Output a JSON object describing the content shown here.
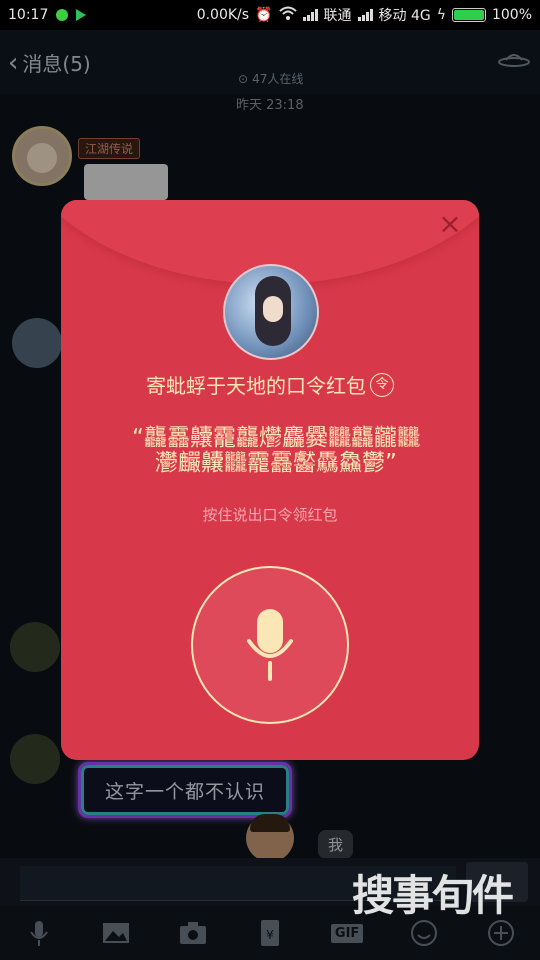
{
  "status_bar": {
    "time": "10:17",
    "speed": "0.00K/s",
    "carrier1": "联通",
    "carrier2": "移动 4G",
    "battery": "100%",
    "battery_level": 1.0
  },
  "nav": {
    "back_label": "消息(5)",
    "online": "47人在线"
  },
  "chat": {
    "timestamp": "昨天 23:18",
    "badge": "江湖传说",
    "neon_message": "这字一个都不认识",
    "me_message": "我"
  },
  "packet": {
    "title": "寄蚍蜉于天地的口令红包",
    "title_icon": "令",
    "password": "“龘靐齉靇龘爩麤爨𪚥龘龖𪚥灪麣齉𪚥龗靐齾驫鱻鬱”",
    "hint": "按住说出口令领红包",
    "close_icon": "close-icon",
    "mic_icon": "microphone-icon"
  },
  "watermark": "搜事旬件",
  "toolbar": {
    "items": [
      "voice-icon",
      "image-icon",
      "camera-icon",
      "red-packet-icon",
      "GIF",
      "emoji-icon",
      "plus-icon"
    ],
    "gif_label": "GIF"
  },
  "colors": {
    "packet_red": "#d8394a",
    "gold_text": "#fbe6b6",
    "hint_pink": "#f6a6ae",
    "neon_purple": "#9d4dff"
  }
}
